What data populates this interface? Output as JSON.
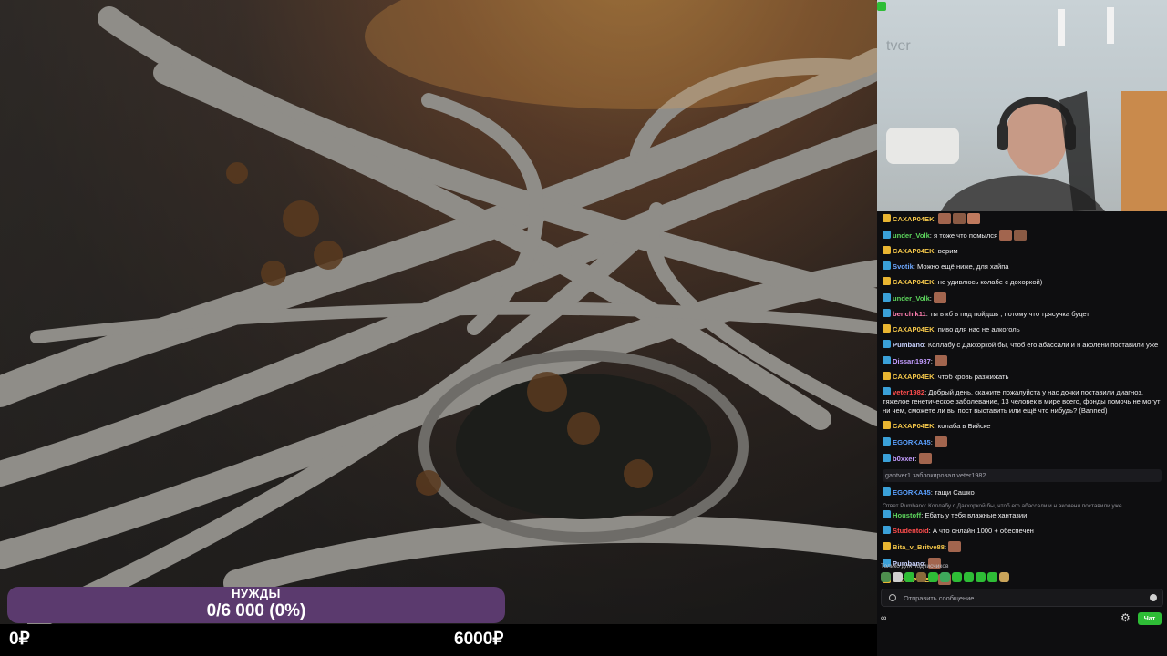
{
  "goal": {
    "title": "НУЖДЫ",
    "progress_text": "0/6 000 (0%)",
    "min_label": "0₽",
    "max_label": "6000₽",
    "fraction": 0
  },
  "stream": {
    "watermark": "tver"
  },
  "colors": {
    "goal_bg": "#5b3a6e",
    "chat_bg": "#0e0e10",
    "accent_green": "#2ebd36"
  },
  "chat": {
    "messages": [
      {
        "nick": "CAXAP04EK",
        "color": "#f5c84b",
        "text": ":",
        "emotes": 3
      },
      {
        "nick": "under_Volk",
        "color": "#5cd35c",
        "text": ": я тоже что помылся",
        "emotes": 2
      },
      {
        "nick": "CAXAP04EK",
        "color": "#f5c84b",
        "text": ": верим"
      },
      {
        "nick": "Svotik",
        "color": "#6ea8ff",
        "text": ": Можно ещё ниже, для хайпа"
      },
      {
        "nick": "CAXAP04EK",
        "color": "#f5c84b",
        "text": ": не удивлюсь колабе с доxоркой)"
      },
      {
        "nick": "under_Volk",
        "color": "#5cd35c",
        "text": ":",
        "emotes": 1
      },
      {
        "nick": "benchik11",
        "color": "#ff7eb0",
        "text": ": ты в кб в пнд пойдшь , потому что трясучка будет"
      },
      {
        "nick": "CAXAP04EK",
        "color": "#f5c84b",
        "text": ": пиво для нас не алкоголь"
      },
      {
        "nick": "Pumbano",
        "color": "#c9d3ff",
        "text": ": Коллабу с Дакхоркой бы, чтоб его абассали и н аколени поставили уже"
      },
      {
        "nick": "Dissan1987",
        "color": "#c39cff",
        "text": ":",
        "emotes": 1
      },
      {
        "nick": "CAXAP04EK",
        "color": "#f5c84b",
        "text": ": чтоб кровь разжижать"
      },
      {
        "nick": "veter1982",
        "color": "#ff4d4d",
        "text": ": Добрый день, скажите пожалуйста у нас дочки поставили диагноз, тяжелое генетическое заболевание, 13 человек в мире всего, фонды помочь не могут ни чем, сможете ли вы пост выставить или ещё что нибудь? (Banned)",
        "wrap": true
      },
      {
        "nick": "CAXAP04EK",
        "color": "#f5c84b",
        "text": ": колаба в Бийске"
      },
      {
        "nick": "EGORKA45",
        "color": "#5aa0ff",
        "text": ":",
        "emotes": 1
      },
      {
        "nick": "b0xxer",
        "color": "#c39cff",
        "text": ":",
        "emotes": 1
      }
    ],
    "system_message": "gantver1 заблокировал veter1982",
    "messages2": [
      {
        "nick": "EGORKA45",
        "color": "#5aa0ff",
        "text": ": тащи Сашко"
      },
      {
        "nick": "Houstoff",
        "color": "#5cd35c",
        "text": ": Ебать у тебя влажные хантазии",
        "reply": "Ответ Pumbano: Коллабу с Дакхоркой бы, чтоб его абассали и н аколени поставили уже"
      },
      {
        "nick": "Studentoid",
        "color": "#ff4d4d",
        "text": ": А что онлайн 1000 + обеспечен"
      },
      {
        "nick": "Bita_v_Britve88",
        "color": "#f5c84b",
        "text": ":",
        "emotes": 1
      },
      {
        "nick": "Pumbano",
        "color": "#c9d3ff",
        "text": ":",
        "emotes": 1
      },
      {
        "nick": "CAXAP04EK",
        "color": "#f5c84b",
        "text": ":",
        "emotes": 1
      }
    ],
    "subs_only": "Только для подписчиков",
    "input_placeholder": "Отправить сообщение",
    "points": "∞",
    "chat_button": "Чат"
  }
}
